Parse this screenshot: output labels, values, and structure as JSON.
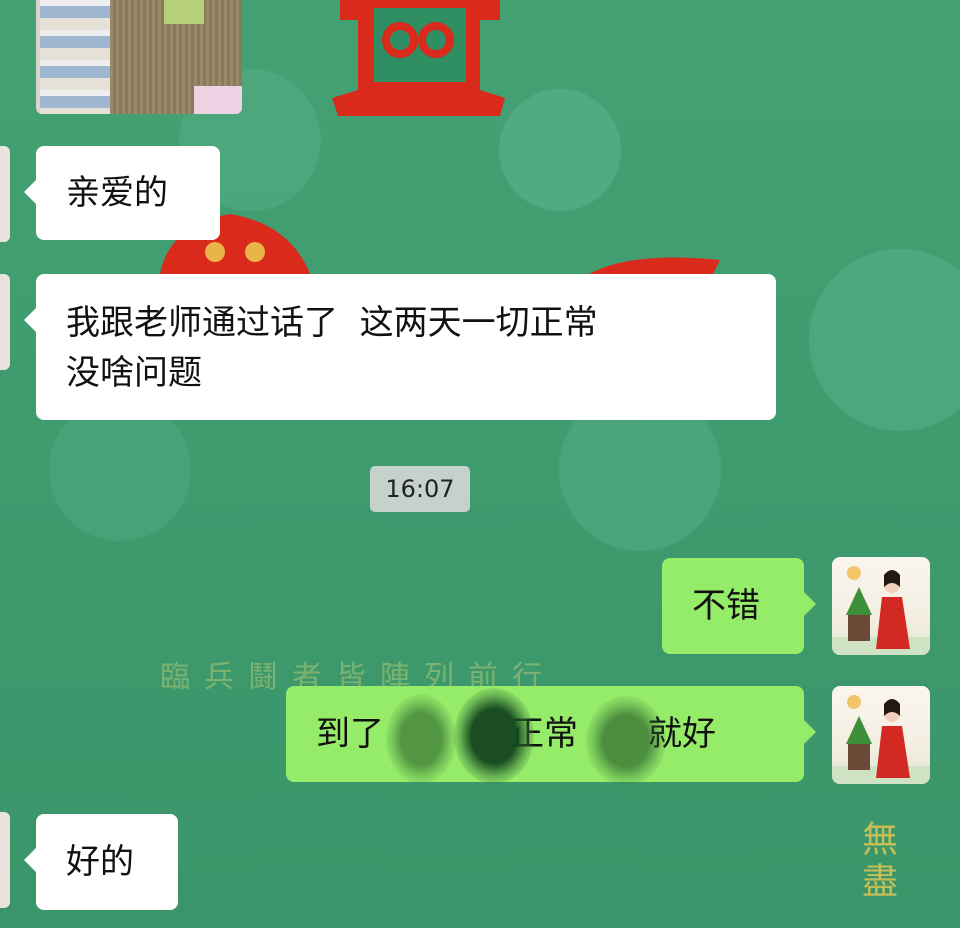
{
  "messages": [
    {
      "id": "m1",
      "side": "in",
      "type": "image"
    },
    {
      "id": "m2",
      "side": "in",
      "text": "亲爱的"
    },
    {
      "id": "m3",
      "side": "in",
      "text_line1": "我跟老师通过话了  这两天一切正常",
      "text_line2": "没啥问题"
    },
    {
      "id": "m4",
      "side": "out",
      "text": "不错"
    },
    {
      "id": "m5",
      "side": "out",
      "text_visible": [
        "到了",
        "正常",
        "就好"
      ]
    },
    {
      "id": "m6",
      "side": "in",
      "text": "好的"
    }
  ],
  "timestamp": "16:07",
  "background_text": "臨兵鬪者皆陣列前行",
  "colors": {
    "chat_background": "#3f9a6e",
    "incoming_bubble": "#ffffff",
    "outgoing_bubble": "#95ec69",
    "timestamp_pill": "#dcdcdc"
  }
}
